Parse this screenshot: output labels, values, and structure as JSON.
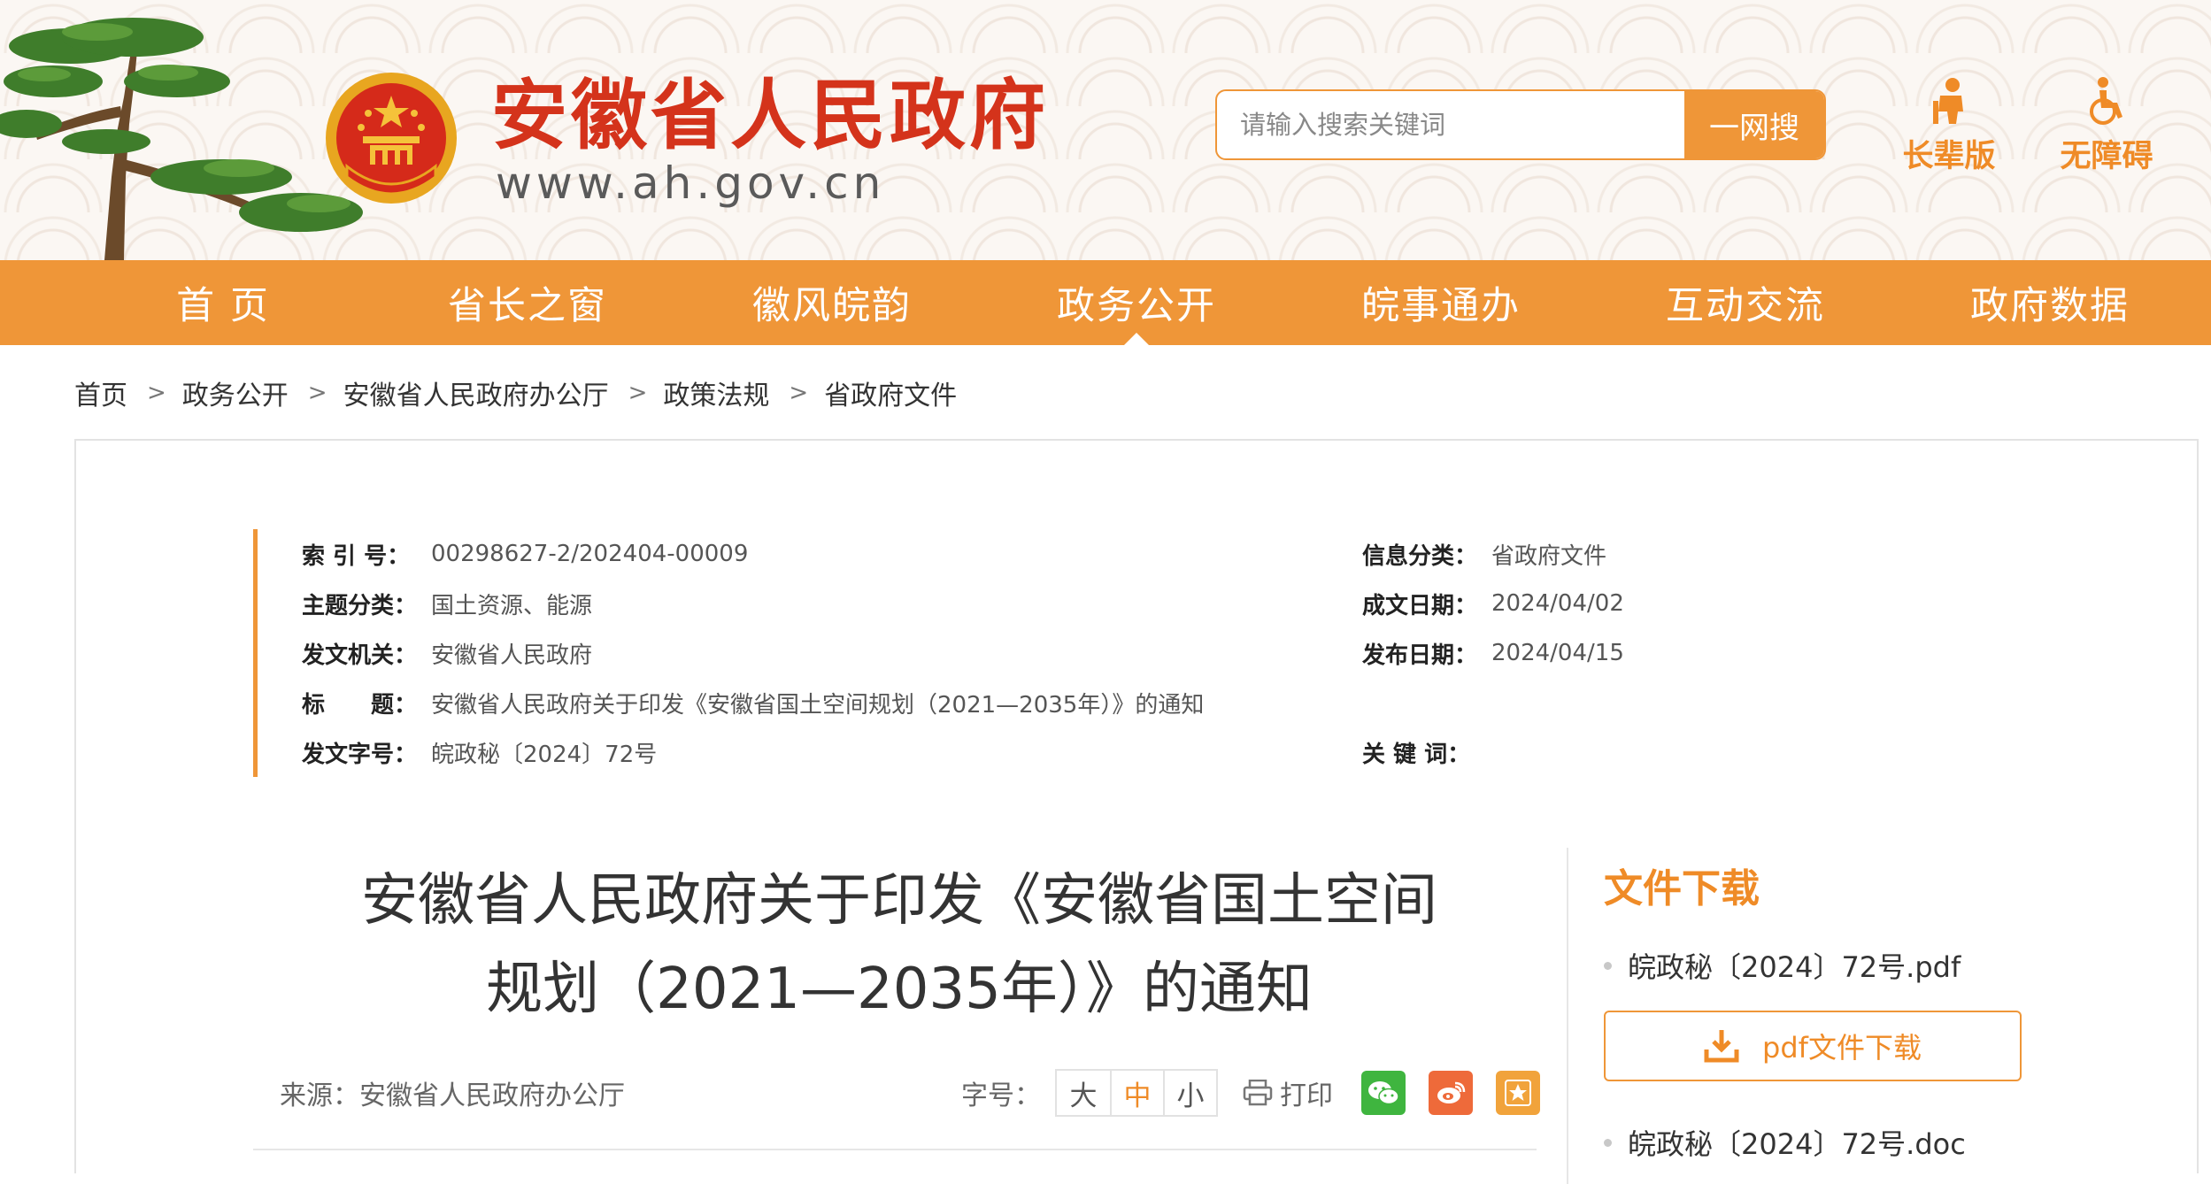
{
  "header": {
    "site_title": "安徽省人民政府",
    "site_url": "www.ah.gov.cn",
    "search_placeholder": "请输入搜索关键词",
    "search_button": "一网搜",
    "elder_mode": "长辈版",
    "accessibility_mode": "无障碍",
    "accent_color": "#ef9638"
  },
  "nav": {
    "items": [
      "首 页",
      "省长之窗",
      "徽风皖韵",
      "政务公开",
      "皖事通办",
      "互动交流",
      "政府数据"
    ],
    "active": "政务公开"
  },
  "breadcrumb": [
    "首页",
    "政务公开",
    "安徽省人民政府办公厅",
    "政策法规",
    "省政府文件"
  ],
  "meta": {
    "index_no_label": "索 引 号：",
    "index_no": "00298627-2/202404-00009",
    "category_label": "信息分类：",
    "category": "省政府文件",
    "topic_label": "主题分类：",
    "topic": "国土资源、能源",
    "written_date_label": "成文日期：",
    "written_date": "2024/04/02",
    "issuer_label": "发文机关：",
    "issuer": "安徽省人民政府",
    "publish_date_label": "发布日期：",
    "publish_date": "2024/04/15",
    "title_label": "标　　题：",
    "title": "安徽省人民政府关于印发《安徽省国土空间规划（2021—2035年）》的通知",
    "doc_no_label": "发文字号：",
    "doc_no": "皖政秘〔2024〕72号",
    "keywords_label": "关 键 词：",
    "keywords": ""
  },
  "article": {
    "title_line1": "安徽省人民政府关于印发《安徽省国土空间",
    "title_line2": "规划（2021—2035年）》的通知",
    "source": "来源：安徽省人民政府办公厅",
    "font_size_label": "字号：",
    "font_sizes": [
      "大",
      "中",
      "小"
    ],
    "font_size_selected": "中",
    "print_label": "打印"
  },
  "downloads": {
    "title": "文件下载",
    "pdf_file": "皖政秘〔2024〕72号.pdf",
    "pdf_button": "pdf文件下载",
    "doc_file": "皖政秘〔2024〕72号.doc"
  },
  "icons": [
    "tree-logo",
    "national-emblem-icon",
    "elder-icon",
    "wheelchair-icon",
    "print-icon",
    "wechat-icon",
    "weibo-icon",
    "star-icon",
    "download-icon"
  ]
}
